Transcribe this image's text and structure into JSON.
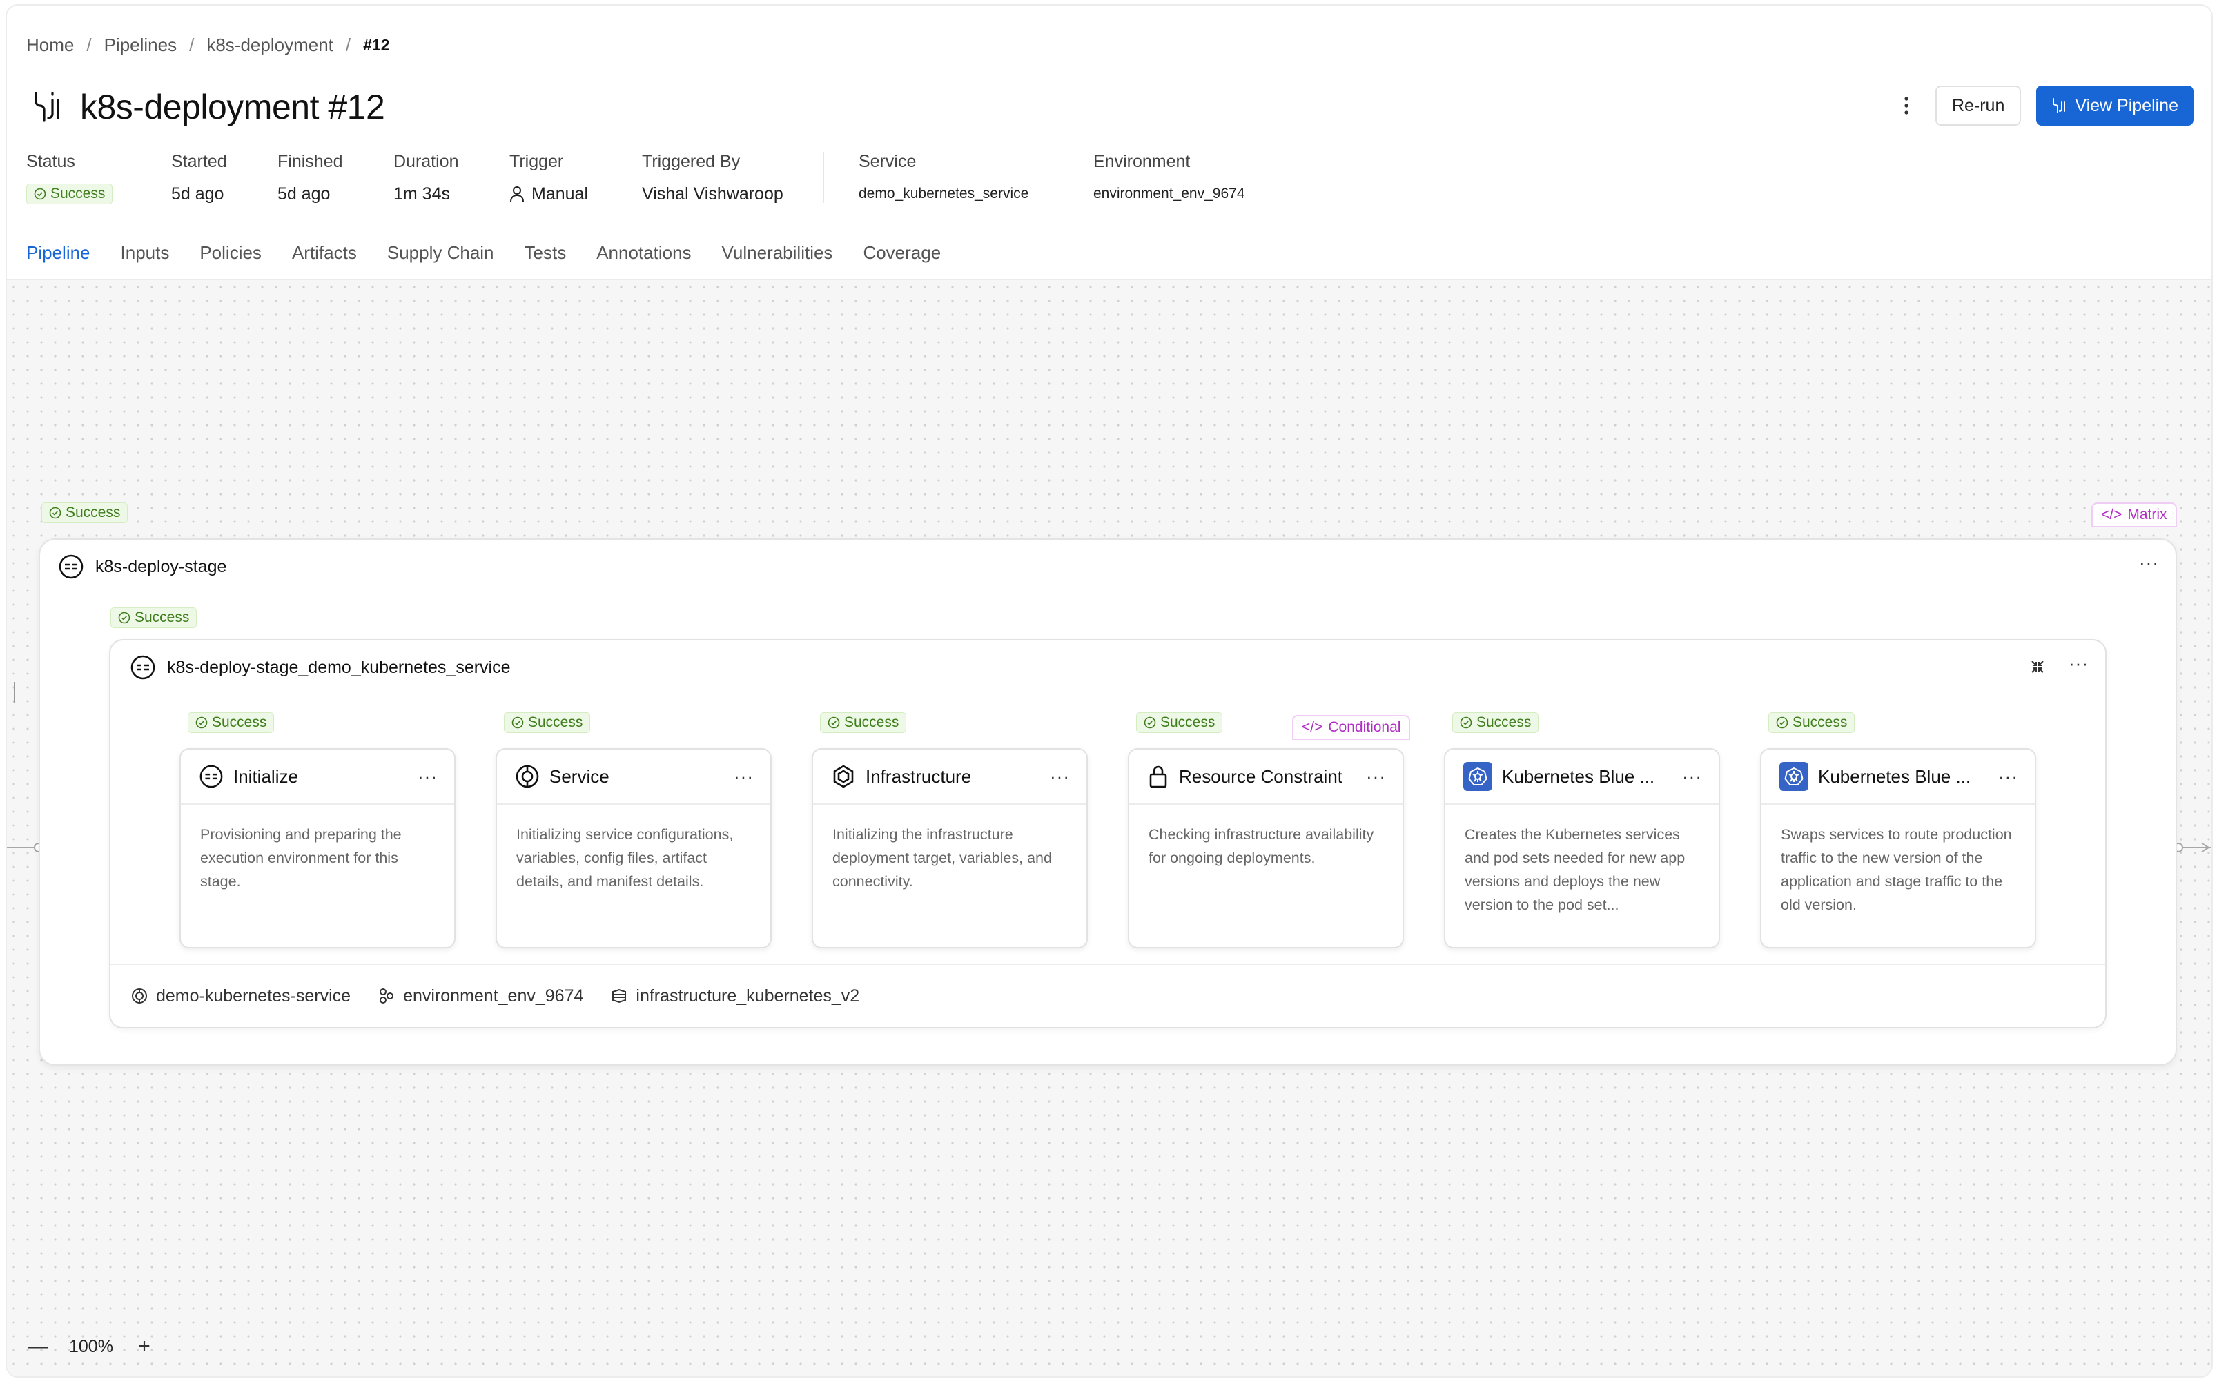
{
  "breadcrumb": {
    "home": "Home",
    "pipelines": "Pipelines",
    "pipeline": "k8s-deployment",
    "current": "#12"
  },
  "title": "k8s-deployment #12",
  "actions": {
    "rerun": "Re-run",
    "view_pipeline": "View Pipeline"
  },
  "meta": {
    "status_label": "Status",
    "status_value": "Success",
    "started_label": "Started",
    "started_value": "5d ago",
    "finished_label": "Finished",
    "finished_value": "5d ago",
    "duration_label": "Duration",
    "duration_value": "1m 34s",
    "trigger_label": "Trigger",
    "trigger_value": "Manual",
    "triggered_by_label": "Triggered By",
    "triggered_by_value": "Vishal Vishwaroop",
    "service_label": "Service",
    "service_value": "demo_kubernetes_service",
    "environment_label": "Environment",
    "environment_value": "environment_env_9674"
  },
  "tabs": [
    "Pipeline",
    "Inputs",
    "Policies",
    "Artifacts",
    "Supply Chain",
    "Tests",
    "Annotations",
    "Vulnerabilities",
    "Coverage"
  ],
  "stage": {
    "status": "Success",
    "name": "k8s-deploy-stage",
    "matrix_label": "Matrix",
    "inner": {
      "status": "Success",
      "name": "k8s-deploy-stage_demo_kubernetes_service",
      "footer": {
        "service": "demo-kubernetes-service",
        "environment": "environment_env_9674",
        "infrastructure": "infrastructure_kubernetes_v2"
      }
    },
    "steps": [
      {
        "status": "Success",
        "name": "Initialize",
        "desc": "Provisioning and preparing the execution environment for this stage."
      },
      {
        "status": "Success",
        "name": "Service",
        "desc": "Initializing service configurations, variables, config files, artifact details, and manifest details."
      },
      {
        "status": "Success",
        "name": "Infrastructure",
        "desc": "Initializing the infrastructure deployment target, variables, and connectivity."
      },
      {
        "status": "Success",
        "name": "Resource Constraint",
        "desc": "Checking infrastructure availability for ongoing deployments.",
        "tag": "Conditional"
      },
      {
        "status": "Success",
        "name": "Kubernetes Blue ...",
        "desc": "Creates the Kubernetes services and pod sets needed for new app versions and deploys the new version to the pod set..."
      },
      {
        "status": "Success",
        "name": "Kubernetes Blue ...",
        "desc": "Swaps services to route production traffic to the new version of the application and stage traffic to the old version."
      }
    ]
  },
  "zoom": {
    "level": "100%"
  },
  "colors": {
    "primary": "#1866d6",
    "success_bg": "#eef8e6",
    "success_text": "#3f7d1d",
    "conditional": "#b02cc4"
  }
}
